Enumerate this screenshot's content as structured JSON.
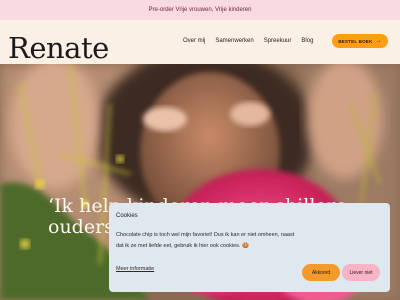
{
  "announcement": {
    "text": "Pre-order Vrije vrouwen, Vrije kinderen"
  },
  "header": {
    "logo": "Renate",
    "nav": [
      {
        "label": "Over mij"
      },
      {
        "label": "Samenwerken"
      },
      {
        "label": "Spreekuur"
      },
      {
        "label": "Blog"
      }
    ],
    "cta": {
      "label": "BESTEL BOEK",
      "icon": "arrow-right-icon"
    }
  },
  "hero": {
    "quote_line1": "‘Ik help kinderen meer chillere",
    "quote_line2": "ouders te hebben.’ – Renate"
  },
  "cookie_banner": {
    "title": "Cookies",
    "body": "Chocolate chip is toch wel mijn favoriet! Dus ik kan er niet omheen, naast dat ik ze met liefde eet, gebruik ik hier ook cookies. 🍪",
    "more_info": "Meer informatie",
    "accept": "Akkoord",
    "decline": "Liever niet"
  },
  "colors": {
    "announcement_bg": "#f9d9e2",
    "page_bg": "#fbf0e6",
    "cta": "#ff9e15",
    "cookie_bg": "#dfe7ef",
    "accept": "#f39a2b",
    "decline": "#f7b4c4"
  }
}
